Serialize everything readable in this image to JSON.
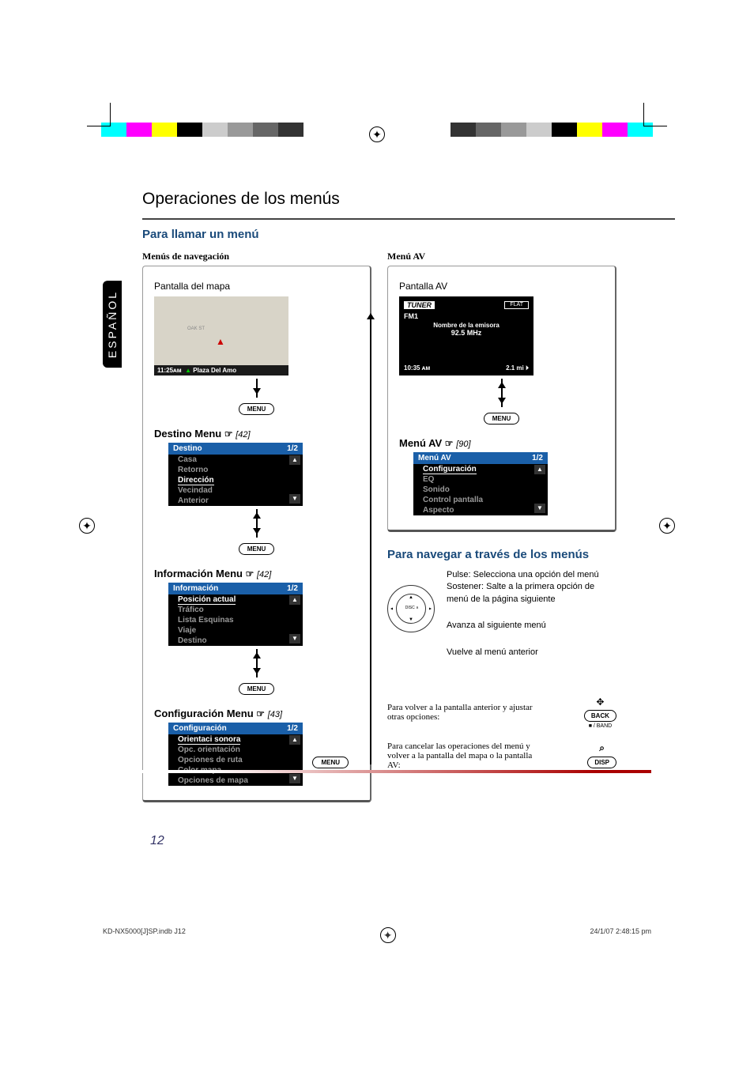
{
  "lang_tab": "ESPAÑOL",
  "title": "Operaciones de los menús",
  "sec1_heading": "Para llamar un menú",
  "left": {
    "sub": "Menús de navegación",
    "map_caption": "Pantalla del mapa",
    "map_street": "OAK ST",
    "map_time": "11:25ᴀᴍ",
    "map_place": "Plaza Del Amo",
    "btn_menu": "MENU",
    "destino": {
      "title": "Destino Menu",
      "ref": "[42]",
      "hdr": "Destino",
      "page": "1/2",
      "items": [
        "Casa",
        "Retorno",
        "Dirección",
        "Vecindad",
        "Anterior"
      ],
      "sel": 2
    },
    "info": {
      "title": "Información Menu",
      "ref": "[42]",
      "hdr": "Información",
      "page": "1/2",
      "items": [
        "Posición actual",
        "Tráfico",
        "Lista Esquinas",
        "Viaje",
        "Destino"
      ],
      "sel": 0
    },
    "config": {
      "title": "Configuración Menu",
      "ref": "[43]",
      "hdr": "Configuración",
      "page": "1/2",
      "items": [
        "Orientaci sonora",
        "Opc. orientación",
        "Opciones de ruta",
        "Color mapa",
        "Opciones de mapa"
      ],
      "sel": 0
    }
  },
  "right": {
    "sub": "Menú AV",
    "av_caption": "Pantalla AV",
    "tuner": "TUNER",
    "flat": "FLAT",
    "band": "FM1",
    "station_label": "Nombre de la emisora",
    "freq": "92.5   MHz",
    "time": "10:35 ᴀᴍ",
    "dist": "2.1 mi",
    "btn_menu": "MENU",
    "avmenu": {
      "title": "Menú AV",
      "ref": "[90]",
      "hdr": "Menú AV",
      "page": "1/2",
      "items": [
        "Configuración",
        "EQ",
        "Sonido",
        "Control pantalla",
        "Aspecto"
      ],
      "sel": 0
    },
    "nav_heading": "Para navegar a través de los menús",
    "nav1": "Pulse: Selecciona una opción del menú",
    "nav1b": "Sostener: Salte a la primera opción de menú de la página siguiente",
    "nav2": "Avanza al siguiente menú",
    "nav3": "Vuelve al menú anterior",
    "note1": "Para volver a la pantalla anterior y ajustar otras opciones:",
    "btn_back": "BACK",
    "back_sub": "■ / BAND",
    "note2": "Para cancelar las operaciones del menú y volver a la pantalla del mapa o la pantalla AV:",
    "btn_disp": "DISP"
  },
  "page_num": "12",
  "footer_left": "KD-NX5000[J]SP.indb   J12",
  "footer_right": "24/1/07   2:48:15 pm"
}
